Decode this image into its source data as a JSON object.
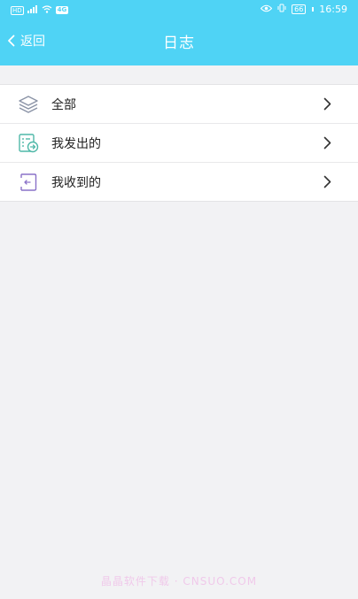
{
  "statusbar": {
    "sim_label": "HD",
    "signal_label": "4G",
    "net_label": "4G",
    "battery": "66",
    "time": "16:59"
  },
  "navbar": {
    "back_label": "返回",
    "title": "日志"
  },
  "menu": {
    "items": [
      {
        "label": "全部",
        "icon": "layers-icon"
      },
      {
        "label": "我发出的",
        "icon": "sent-log-icon"
      },
      {
        "label": "我收到的",
        "icon": "received-log-icon"
      }
    ]
  },
  "watermark": "晶晶软件下载 · CNSUO.COM",
  "colors": {
    "header": "#4fd3f5",
    "background": "#f2f2f4",
    "icon_gray": "#8a93a6",
    "icon_teal": "#4fb8a8",
    "icon_purple": "#8a72c8"
  }
}
